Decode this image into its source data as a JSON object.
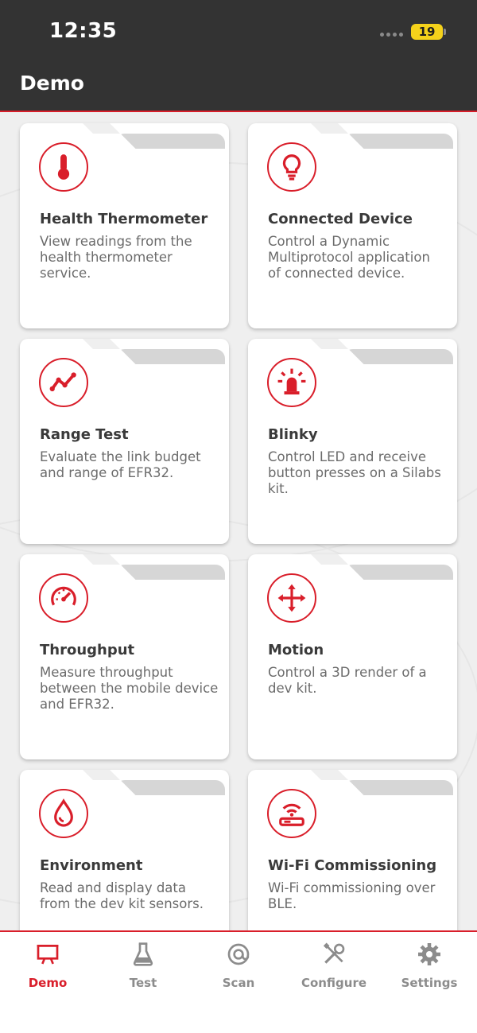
{
  "status": {
    "time": "12:35",
    "battery": "19"
  },
  "header": {
    "title": "Demo"
  },
  "cards": [
    {
      "title": "Health Thermometer",
      "description": "View readings from the health thermometer service.",
      "icon": "thermometer-icon"
    },
    {
      "title": "Connected Device",
      "description": "Control a Dynamic Multiprotocol application of connected device.",
      "icon": "lightbulb-icon"
    },
    {
      "title": "Range Test",
      "description": "Evaluate the link budget and range of EFR32.",
      "icon": "line-chart-icon"
    },
    {
      "title": "Blinky",
      "description": "Control LED and receive button presses on a Silabs kit.",
      "icon": "led-icon"
    },
    {
      "title": "Throughput",
      "description": "Measure throughput between the mobile device and EFR32.",
      "icon": "speedometer-icon"
    },
    {
      "title": "Motion",
      "description": "Control a 3D render of a dev kit.",
      "icon": "move-arrows-icon"
    },
    {
      "title": "Environment",
      "description": "Read and display data from the dev kit sensors.",
      "icon": "droplet-icon"
    },
    {
      "title": "Wi-Fi Commissioning",
      "description": "Wi-Fi commissioning over BLE.",
      "icon": "wifi-router-icon"
    }
  ],
  "tabs": [
    {
      "label": "Demo",
      "icon": "presentation-icon",
      "active": true
    },
    {
      "label": "Test",
      "icon": "flask-icon",
      "active": false
    },
    {
      "label": "Scan",
      "icon": "at-target-icon",
      "active": false
    },
    {
      "label": "Configure",
      "icon": "tools-icon",
      "active": false
    },
    {
      "label": "Settings",
      "icon": "gear-icon",
      "active": false
    }
  ],
  "colors": {
    "accent": "#d91e2a",
    "header": "#333333",
    "background": "#efefef",
    "tab_inactive": "#8c8c8c"
  }
}
